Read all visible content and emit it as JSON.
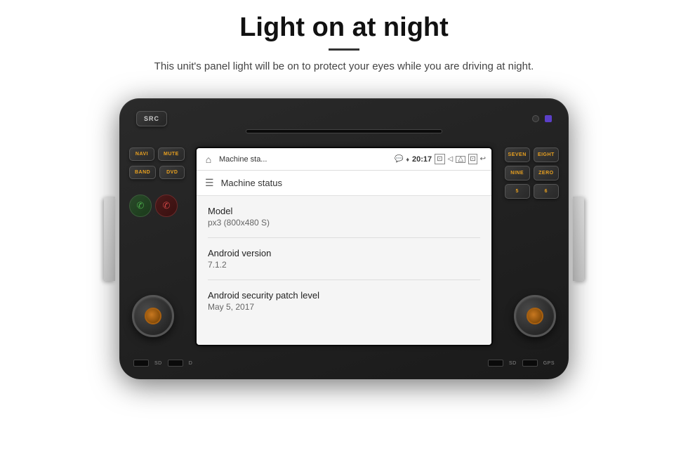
{
  "page": {
    "title": "Light on at night",
    "divider": true,
    "subtitle": "This unit's panel light will be on to protect your eyes while you are driving at night."
  },
  "unit": {
    "top_button": "SRC",
    "left_buttons": [
      {
        "label": "NAVI",
        "row": 0
      },
      {
        "label": "MUTE",
        "row": 0
      },
      {
        "label": "BAND",
        "row": 1
      },
      {
        "label": "DVD",
        "row": 1
      }
    ],
    "right_buttons": [
      "SEVEN",
      "EIGHT",
      "NINE",
      "ZERO",
      "5",
      "6"
    ],
    "bottom_left": [
      "SD",
      "D"
    ],
    "bottom_right": [
      "SD",
      "GPS"
    ]
  },
  "screen": {
    "status_bar": {
      "app_name": "Machine sta...",
      "chat_icon": "💬",
      "nav_icon": "♦",
      "time": "20:17",
      "media_icon": "⊡",
      "volume_icon": "◁",
      "cast_icon": "⊿",
      "screen_icon": "⊡",
      "back_icon": "↩"
    },
    "app_bar": {
      "title": "Machine status"
    },
    "info_items": [
      {
        "label": "Model",
        "value": "px3 (800x480 S)"
      },
      {
        "label": "Android version",
        "value": "7.1.2"
      },
      {
        "label": "Android security patch level",
        "value": "May 5, 2017"
      }
    ]
  }
}
